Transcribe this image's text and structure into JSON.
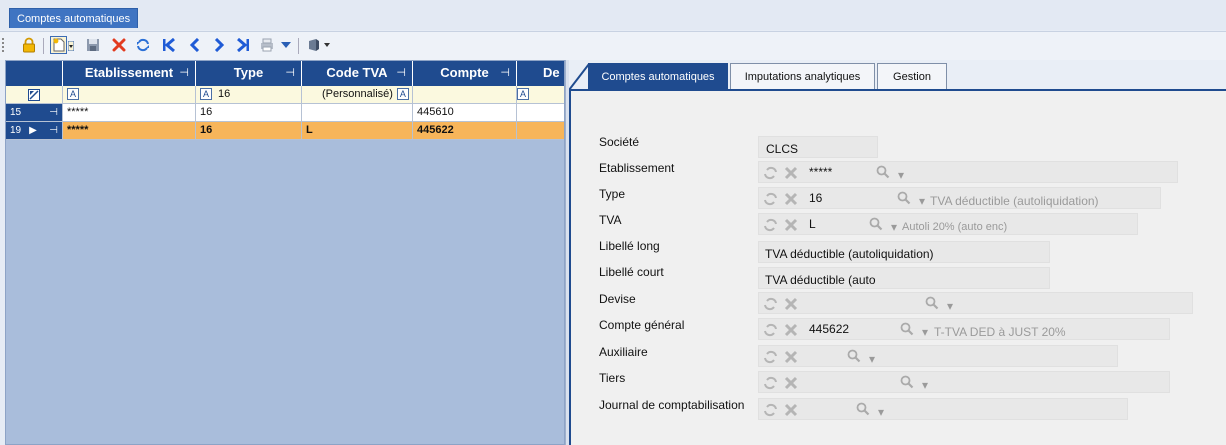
{
  "window": {
    "tab_label": "Comptes automatiques"
  },
  "toolbar": {
    "icons": [
      "lock-icon",
      "new-record-icon",
      "save-icon",
      "delete-icon",
      "refresh-icon",
      "first-record-icon",
      "previous-record-icon",
      "next-record-icon",
      "last-record-icon",
      "print-icon",
      "filter-dropdown-icon",
      "export-icon"
    ]
  },
  "grid": {
    "columns": [
      "Etablissement",
      "Type",
      "Code TVA",
      "Compte",
      "De"
    ],
    "pin_glyph": "⊣",
    "filter_row": {
      "marker": "A",
      "type": "16",
      "code_tva": "(Personnalisé)"
    },
    "rows": [
      {
        "num": "15",
        "etablissement": "*****",
        "type": "16",
        "code_tva": "",
        "compte": "445610",
        "selected": false
      },
      {
        "num": "19",
        "etablissement": "*****",
        "type": "16",
        "code_tva": "L",
        "compte": "445622",
        "selected": true
      }
    ]
  },
  "detail_tabs": [
    "Comptes automatiques",
    "Imputations analytiques",
    "Gestion"
  ],
  "form": {
    "societe": {
      "label": "Société",
      "value": "CLCS"
    },
    "etablissement": {
      "label": "Etablissement",
      "value": "*****",
      "desc": ""
    },
    "type": {
      "label": "Type",
      "value": "16",
      "desc": "TVA déductible (autoliquidation)"
    },
    "tva": {
      "label": "TVA",
      "value": "L",
      "desc": "Autoli 20% (auto enc)"
    },
    "libelle_long": {
      "label": "Libellé long",
      "value": "TVA déductible (autoliquidation)"
    },
    "libelle_court": {
      "label": "Libellé court",
      "value": "TVA déductible (auto"
    },
    "devise": {
      "label": "Devise",
      "value": "",
      "desc": ""
    },
    "compte_general": {
      "label": "Compte général",
      "value": "445622",
      "desc": "T-TVA DED à  JUST 20%"
    },
    "auxiliaire": {
      "label": "Auxiliaire",
      "value": "",
      "desc": ""
    },
    "tiers": {
      "label": "Tiers",
      "value": "",
      "desc": ""
    },
    "journal": {
      "label": "Journal de comptabilisation",
      "value": "",
      "desc": ""
    }
  },
  "colors": {
    "header_blue": "#1f4b8f",
    "selected_row": "#f7b55a",
    "filter_row": "#fbf9df",
    "grid_bg": "#a9bddb"
  }
}
